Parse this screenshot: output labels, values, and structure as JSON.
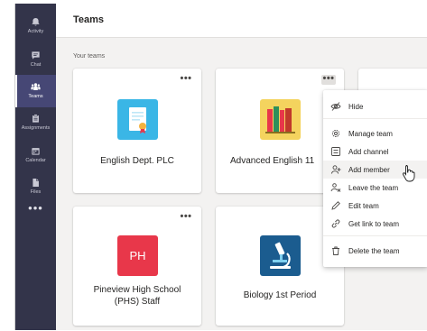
{
  "rail": {
    "items": [
      {
        "label": "Activity",
        "icon": "bell-icon"
      },
      {
        "label": "Chat",
        "icon": "chat-icon"
      },
      {
        "label": "Teams",
        "icon": "teams-icon"
      },
      {
        "label": "Assignments",
        "icon": "assignments-icon"
      },
      {
        "label": "Calendar",
        "icon": "calendar-icon"
      },
      {
        "label": "Files",
        "icon": "files-icon"
      }
    ],
    "active": "Teams",
    "more": "•••"
  },
  "header": {
    "title": "Teams"
  },
  "section_label": "Your teams",
  "teams": [
    {
      "name": "English Dept. PLC",
      "avatar_color": "#3ab6e6"
    },
    {
      "name": "Advanced English 11",
      "avatar_color": "#f4d35e"
    },
    {
      "name_line1": "Pineview High School",
      "name_line2": "(PHS) Staff",
      "initials": "PH",
      "avatar_color": "#e8374a"
    },
    {
      "name": "Biology 1st Period",
      "avatar_color": "#1b5c8f"
    }
  ],
  "more_label": "•••",
  "menu": {
    "items": [
      {
        "label": "Hide",
        "icon": "hide-icon"
      },
      {
        "label": "Manage team",
        "icon": "gear-icon"
      },
      {
        "label": "Add channel",
        "icon": "add-channel-icon"
      },
      {
        "label": "Add member",
        "icon": "add-member-icon"
      },
      {
        "label": "Leave the team",
        "icon": "leave-icon"
      },
      {
        "label": "Edit team",
        "icon": "pencil-icon"
      },
      {
        "label": "Get link to team",
        "icon": "link-icon"
      },
      {
        "label": "Delete the team",
        "icon": "trash-icon"
      }
    ],
    "hovered": "Add member"
  },
  "colors": {
    "rail": "#33344a",
    "rail_active": "#464775",
    "accent": "#6264a7"
  }
}
